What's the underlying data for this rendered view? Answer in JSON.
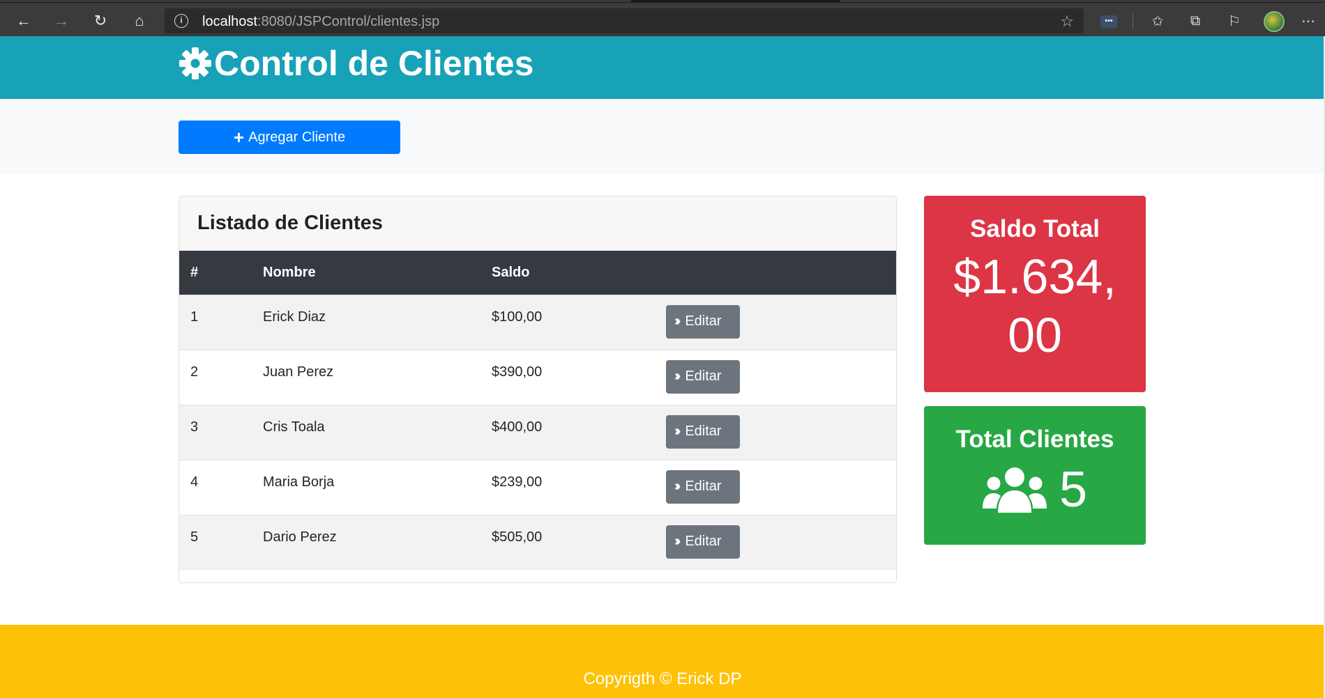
{
  "browser": {
    "url_host": "localhost",
    "url_rest": ":8080/JSPControl/clientes.jsp",
    "extension_label": "•••"
  },
  "header": {
    "title": "Control de Clientes"
  },
  "actions": {
    "add_button_label": "Agregar Cliente"
  },
  "card": {
    "title": "Listado de Clientes",
    "columns": [
      "#",
      "Nombre",
      "Saldo",
      ""
    ],
    "rows": [
      {
        "id": "1",
        "nombre": "Erick Diaz",
        "saldo": "$100,00",
        "action": "Editar"
      },
      {
        "id": "2",
        "nombre": "Juan Perez",
        "saldo": "$390,00",
        "action": "Editar"
      },
      {
        "id": "3",
        "nombre": "Cris Toala",
        "saldo": "$400,00",
        "action": "Editar"
      },
      {
        "id": "4",
        "nombre": "Maria Borja",
        "saldo": "$239,00",
        "action": "Editar"
      },
      {
        "id": "5",
        "nombre": "Dario Perez",
        "saldo": "$505,00",
        "action": "Editar"
      }
    ]
  },
  "stats": {
    "saldo_title": "Saldo Total",
    "saldo_value": "$1.634,00",
    "clientes_title": "Total Clientes",
    "clientes_value": "5"
  },
  "footer": {
    "copyright": "Copyrigth © Erick DP"
  },
  "colors": {
    "header_bg": "#17a2b8",
    "add_button": "#007bff",
    "table_head": "#343a40",
    "edit_button": "#6c757d",
    "saldo_box": "#dc3545",
    "clientes_box": "#28a745",
    "footer_bg": "#ffc107"
  }
}
